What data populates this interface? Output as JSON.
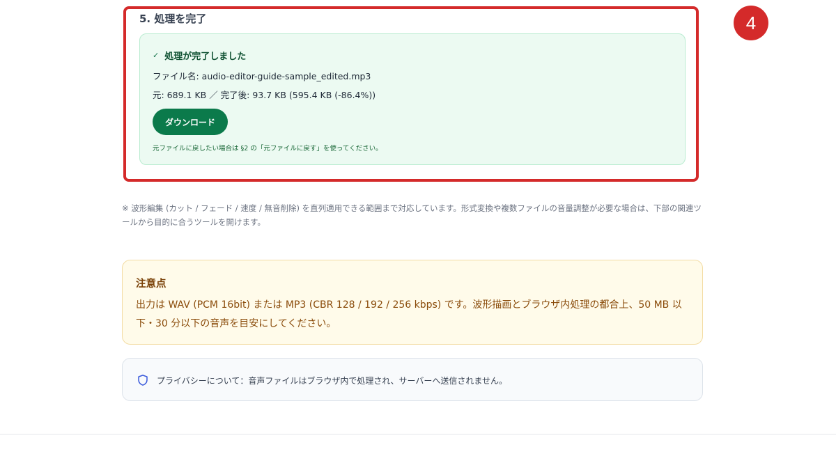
{
  "step_badge": "4",
  "section": {
    "title": "5. 処理を完了"
  },
  "result": {
    "status": "処理が完了しました",
    "filename": "ファイル名: audio-editor-guide-sample_edited.mp3",
    "size": "元: 689.1 KB ／ 完了後: 93.7 KB (595.4 KB (-86.4%))",
    "download_label": "ダウンロード",
    "restore_note": "元ファイルに戻したい場合は §2 の「元ファイルに戻す」を使ってください。"
  },
  "footnote": "※ 波形編集 (カット / フェード / 速度 / 無音削除) を直列適用できる範囲まで対応しています。形式変換や複数ファイルの音量調整が必要な場合は、下部の関連ツールから目的に合うツールを開けます。",
  "caution": {
    "title": "注意点",
    "body": "出力は WAV (PCM 16bit) または MP3 (CBR 128 / 192 / 256 kbps) です。波形描画とブラウザ内処理の都合上、50 MB 以下・30 分以下の音声を目安にしてください。"
  },
  "privacy": {
    "text": "プライバシーについて：音声ファイルはブラウザ内で処理され、サーバーへ送信されません。"
  },
  "colors": {
    "highlight": "#d42a2a",
    "success_bg": "#ecfaf2",
    "download_button": "#0b7a4b",
    "caution_bg": "#fffbea",
    "caution_text": "#8a4b0a",
    "privacy_icon": "#3b5bdb"
  },
  "icons": {
    "status": "check-icon",
    "privacy": "shield-icon"
  }
}
